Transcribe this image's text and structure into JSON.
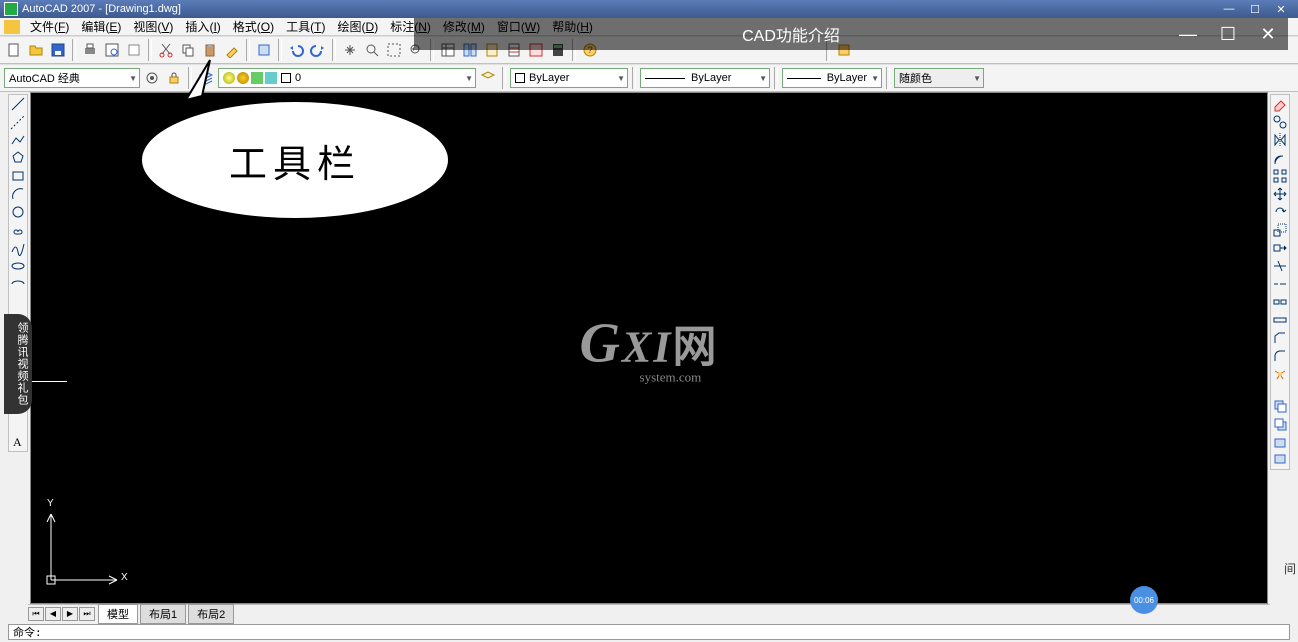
{
  "window": {
    "app_title": "AutoCAD 2007 - [Drawing1.dwg]",
    "min": "—",
    "max": "☐",
    "close": "✕"
  },
  "menu": {
    "items": [
      {
        "label": "文件",
        "accel": "F"
      },
      {
        "label": "编辑",
        "accel": "E"
      },
      {
        "label": "视图",
        "accel": "V"
      },
      {
        "label": "插入",
        "accel": "I"
      },
      {
        "label": "格式",
        "accel": "O"
      },
      {
        "label": "工具",
        "accel": "T"
      },
      {
        "label": "绘图",
        "accel": "D"
      },
      {
        "label": "标注",
        "accel": "N"
      },
      {
        "label": "修改",
        "accel": "M"
      },
      {
        "label": "窗口",
        "accel": "W"
      },
      {
        "label": "帮助",
        "accel": "H"
      }
    ]
  },
  "overlay": {
    "title": "CAD功能介绍",
    "min": "—",
    "max": "☐",
    "close": "✕"
  },
  "toolbar2": {
    "workspace": "AutoCAD 经典",
    "bylayer_color": "ByLayer",
    "bylayer_ltype": "ByLayer",
    "bylayer_lweight": "ByLayer",
    "plotstyle": "随颜色"
  },
  "callout": {
    "text": "工具栏"
  },
  "watermark": {
    "main": "GXI网",
    "sub": "system.com"
  },
  "ucs": {
    "x": "X",
    "y": "Y"
  },
  "tabs": {
    "nav": [
      "⏮",
      "◀",
      "▶",
      "⏭"
    ],
    "items": [
      "模型",
      "布局1",
      "布局2"
    ]
  },
  "cmdline": {
    "prompt": "命令:"
  },
  "side_tab": "领腾讯视频礼包",
  "video_time": "00:06",
  "edge_text": "间"
}
